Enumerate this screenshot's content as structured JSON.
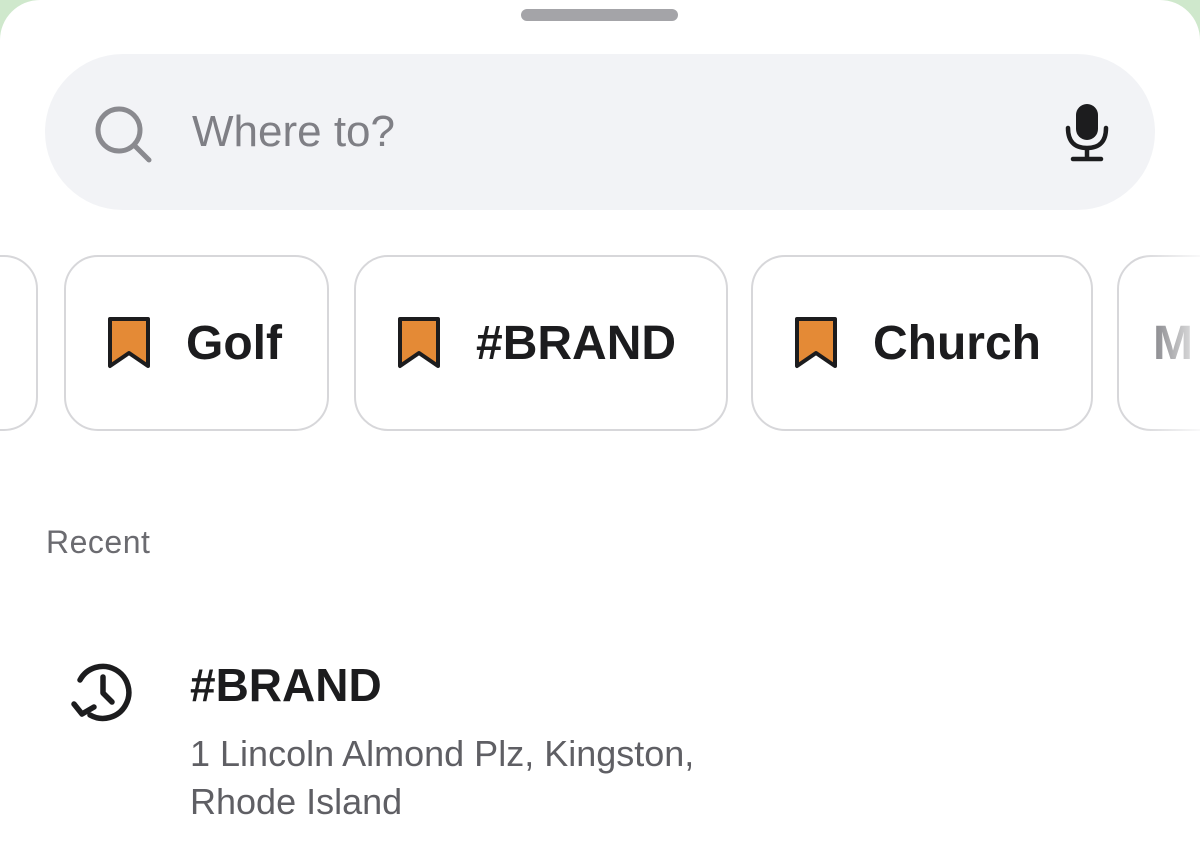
{
  "search": {
    "placeholder": "Where to?",
    "value": "",
    "left_icon": "search-icon",
    "right_icon": "microphone-icon"
  },
  "categories": [
    {
      "label": "Golf",
      "icon": "bookmark-icon"
    },
    {
      "label": "#BRAND",
      "icon": "bookmark-icon"
    },
    {
      "label": "Church",
      "icon": "bookmark-icon"
    },
    {
      "label": "M",
      "icon": "",
      "partial": true
    }
  ],
  "recent": {
    "title": "Recent",
    "items": [
      {
        "name": "#BRAND",
        "address": "1 Lincoln Almond Plz, Kingston, Rhode Island",
        "icon": "history-icon"
      }
    ]
  },
  "colors": {
    "bookmark_fill": "#E48A36",
    "search_background": "#F2F3F6",
    "chip_border": "#D7D7DA",
    "background_tint": "#CFE8CC"
  }
}
